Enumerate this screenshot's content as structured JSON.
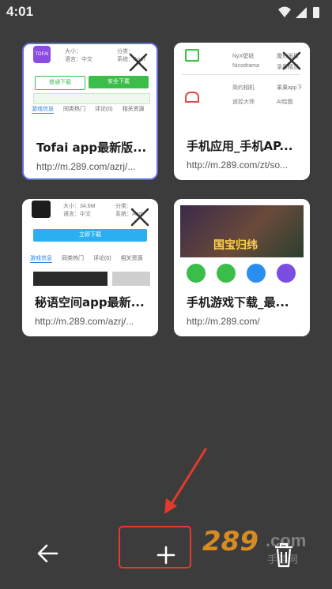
{
  "status": {
    "time": "4:01"
  },
  "tabs": [
    {
      "title": "Tofai app最新版...",
      "url": "http://m.289.com/azrj/...",
      "thumb": {
        "logo": "TOFAI",
        "meta": [
          "大小：",
          "语言：中文",
          "分类：",
          "系统：Andr"
        ],
        "buttons": [
          "普通下载",
          "安全下载"
        ],
        "tabs": [
          "游戏信息",
          "同类热门",
          "评论(0)",
          "相关资源"
        ]
      }
    },
    {
      "title": "手机应用_手机AP...",
      "url": "http://m.289.com/zt/so...",
      "thumb": {
        "rows": [
          "NyX壁纸",
          "魔幻画板",
          "Nicodrama",
          "录屏精灵",
          "简约相机",
          "果果app下",
          "遥控大师",
          "AI绘图"
        ]
      }
    },
    {
      "title": "秘语空间app最新...",
      "url": "http://m.289.com/azrj/...",
      "thumb": {
        "meta": [
          "大小：34.6M",
          "语言：中文",
          "分类：",
          "系统：Andr"
        ],
        "button": "立即下载",
        "tabs": [
          "游戏信息",
          "同类热门",
          "评论(0)",
          "相关资源"
        ]
      }
    },
    {
      "title": "手机游戏下载_最...",
      "url": "http://m.289.com/",
      "thumb": {
        "banner_text": "国宝归纬"
      }
    }
  ],
  "watermark": {
    "main": "289",
    "suffix": ".com",
    "sub": "手游网"
  },
  "colors": {
    "background": "#3c3c3c",
    "accent_green": "#3bbd4a",
    "highlight_red": "#e23b2b"
  }
}
